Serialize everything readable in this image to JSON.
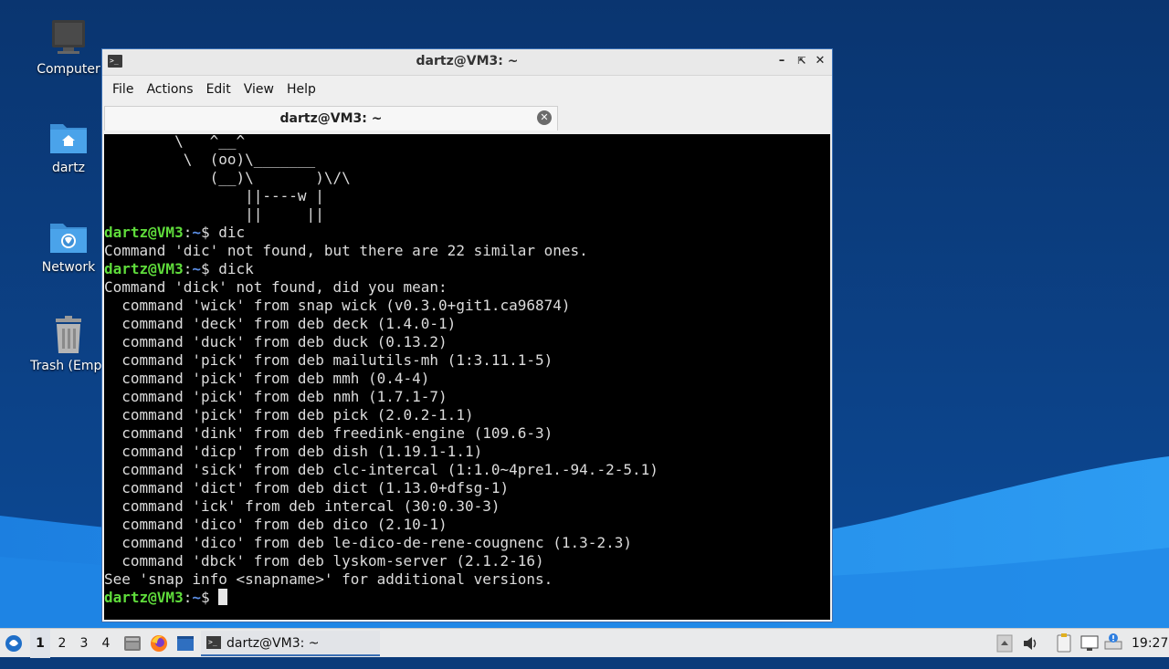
{
  "desktop": {
    "icons": [
      {
        "label": "Computer",
        "icon": "computer-icon"
      },
      {
        "label": "dartz",
        "icon": "home-folder-icon"
      },
      {
        "label": "Network",
        "icon": "network-folder-icon"
      },
      {
        "label": "Trash (Empt",
        "icon": "trash-icon"
      }
    ]
  },
  "window": {
    "title": "dartz@VM3: ~",
    "menu": [
      "File",
      "Actions",
      "Edit",
      "View",
      "Help"
    ],
    "tab_label": "dartz@VM3: ~",
    "controls": [
      "minimize-icon",
      "maximize-icon",
      "close-icon"
    ]
  },
  "terminal": {
    "lines": [
      {
        "text": "        \\   ^__^"
      },
      {
        "text": "         \\  (oo)\\_______"
      },
      {
        "text": "            (__)\\       )\\/\\"
      },
      {
        "text": "                ||----w |"
      },
      {
        "text": "                ||     ||"
      },
      {
        "user": "dartz@VM3",
        "path": "~",
        "cmd": "$ dic"
      },
      {
        "text": "Command 'dic' not found, but there are 22 similar ones."
      },
      {
        "user": "dartz@VM3",
        "path": "~",
        "cmd": "$ dick"
      },
      {
        "text": "Command 'dick' not found, did you mean:"
      },
      {
        "text": "  command 'wick' from snap wick (v0.3.0+git1.ca96874)"
      },
      {
        "text": "  command 'deck' from deb deck (1.4.0-1)"
      },
      {
        "text": "  command 'duck' from deb duck (0.13.2)"
      },
      {
        "text": "  command 'pick' from deb mailutils-mh (1:3.11.1-5)"
      },
      {
        "text": "  command 'pick' from deb mmh (0.4-4)"
      },
      {
        "text": "  command 'pick' from deb nmh (1.7.1-7)"
      },
      {
        "text": "  command 'pick' from deb pick (2.0.2-1.1)"
      },
      {
        "text": "  command 'dink' from deb freedink-engine (109.6-3)"
      },
      {
        "text": "  command 'dicp' from deb dish (1.19.1-1.1)"
      },
      {
        "text": "  command 'sick' from deb clc-intercal (1:1.0~4pre1.-94.-2-5.1)"
      },
      {
        "text": "  command 'dict' from deb dict (1.13.0+dfsg-1)"
      },
      {
        "text": "  command 'ick' from deb intercal (30:0.30-3)"
      },
      {
        "text": "  command 'dico' from deb dico (2.10-1)"
      },
      {
        "text": "  command 'dico' from deb le-dico-de-rene-cougnenc (1.3-2.3)"
      },
      {
        "text": "  command 'dbck' from deb lyskom-server (2.1.2-16)"
      },
      {
        "text": "See 'snap info <snapname>' for additional versions."
      },
      {
        "user": "dartz@VM3",
        "path": "~",
        "cmd": "$ ",
        "cursor": true
      }
    ]
  },
  "taskbar": {
    "workspaces": [
      "1",
      "2",
      "3",
      "4"
    ],
    "active_workspace": "1",
    "task_label": "dartz@VM3: ~",
    "clock": "19:27",
    "launchers": [
      "start-menu-icon",
      "file-manager-icon",
      "firefox-icon",
      "show-desktop-icon"
    ],
    "tray": [
      "tray-arrow-icon",
      "volume-icon",
      "clipboard-icon",
      "network-monitor-icon",
      "notification-icon"
    ]
  },
  "colors": {
    "prompt_user": "#5fdc3b",
    "prompt_path": "#5c8fe6",
    "window_border": "#3a6fb4"
  }
}
